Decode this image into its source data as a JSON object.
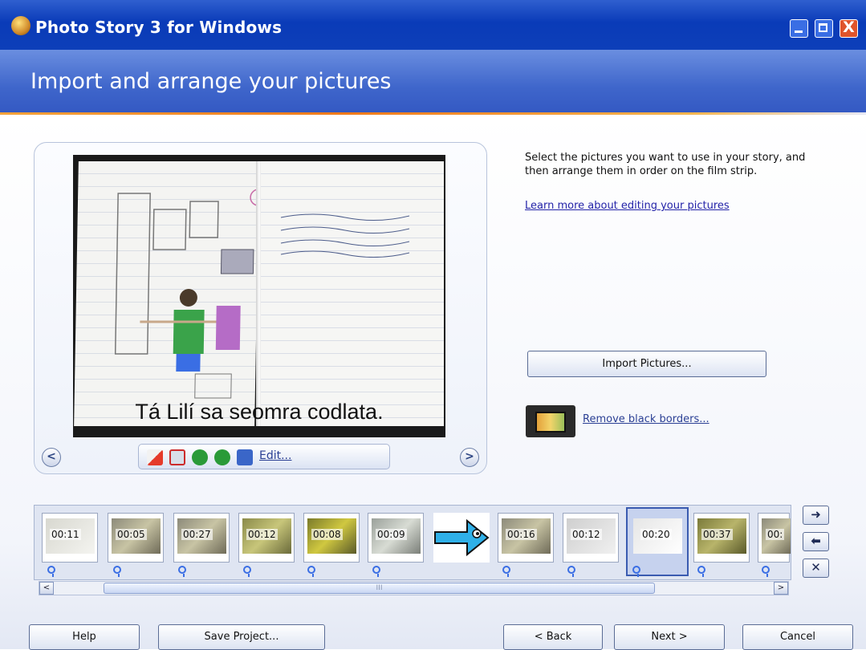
{
  "window": {
    "title": "Photo Story 3 for Windows",
    "controls": [
      "minimize",
      "maximize",
      "close"
    ],
    "close_label": "X"
  },
  "header": {
    "title": "Import and arrange your pictures"
  },
  "preview": {
    "caption": "Tá Lilí sa seomra codlata.",
    "edit_label": "Edit...",
    "prev_label": "<",
    "next_label": ">"
  },
  "right_pane": {
    "instructions": "Select the pictures you want to use in your story, and then arrange them in order on the film strip.",
    "learn_more": "Learn more about editing your pictures",
    "import_button": "Import Pictures...",
    "remove_borders": "Remove black borders..."
  },
  "filmstrip": {
    "frames": [
      {
        "time": "00:11",
        "selected": false
      },
      {
        "time": "00:05",
        "selected": false
      },
      {
        "time": "00:27",
        "selected": false
      },
      {
        "time": "00:12",
        "selected": false
      },
      {
        "time": "00:08",
        "selected": false
      },
      {
        "time": "00:09",
        "selected": false
      },
      {
        "time": "",
        "selected": false
      },
      {
        "time": "00:16",
        "selected": false
      },
      {
        "time": "00:12",
        "selected": false
      },
      {
        "time": "00:20",
        "selected": true
      },
      {
        "time": "00:37",
        "selected": false
      },
      {
        "time": "00:",
        "selected": false
      }
    ],
    "move_right": "➜",
    "move_left": "⬅",
    "delete": "✕",
    "scroll_left": "<",
    "scroll_right": ">",
    "scroll_grip": "III"
  },
  "buttons": {
    "help": "Help",
    "save_project": "Save Project...",
    "back": "< Back",
    "next": "Next >",
    "cancel": "Cancel"
  }
}
